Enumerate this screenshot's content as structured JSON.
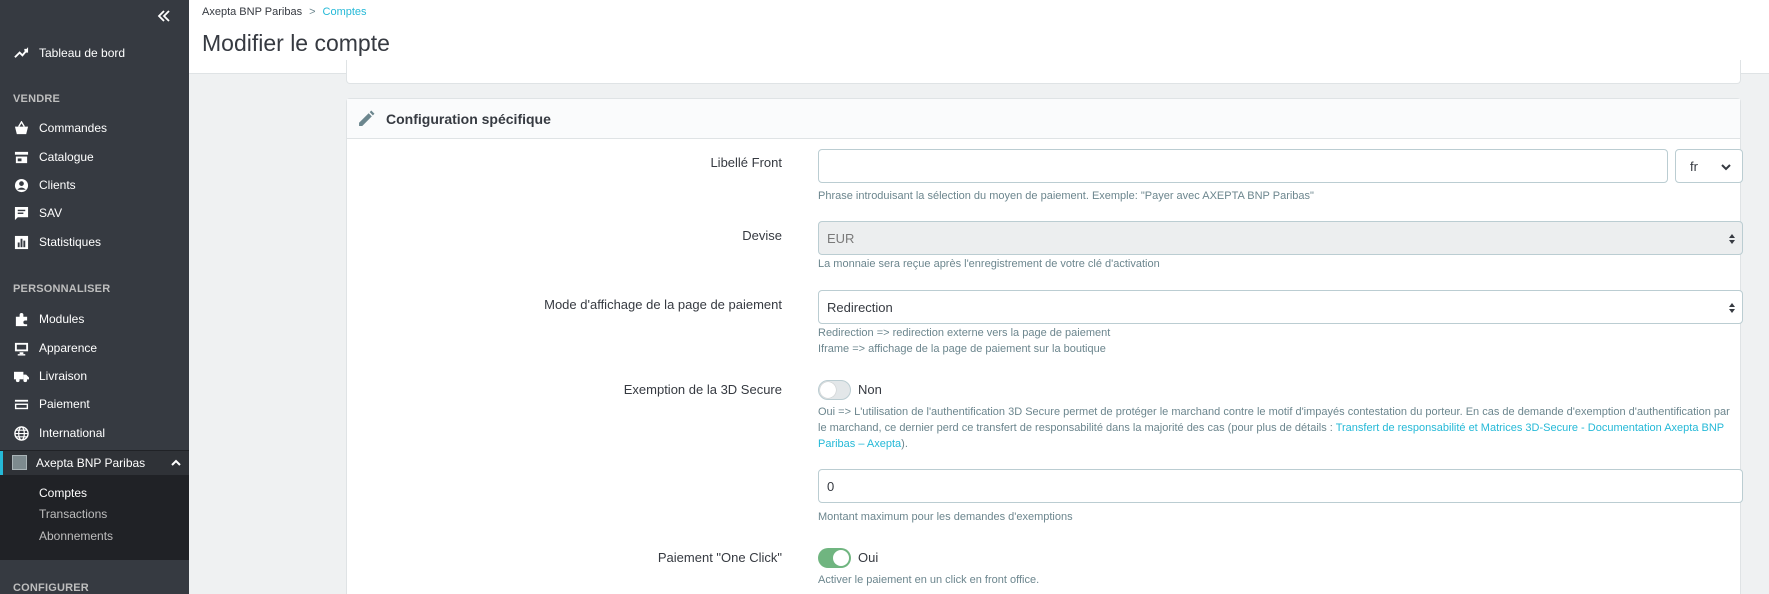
{
  "sidebar": {
    "dashboard": "Tableau de bord",
    "sections": {
      "sell": "VENDRE",
      "customize": "PERSONNALISER",
      "configure": "CONFIGURER"
    },
    "sell_items": [
      {
        "label": "Commandes",
        "icon": "basket-icon"
      },
      {
        "label": "Catalogue",
        "icon": "store-icon"
      },
      {
        "label": "Clients",
        "icon": "user-circle-icon"
      },
      {
        "label": "SAV",
        "icon": "message-icon"
      },
      {
        "label": "Statistiques",
        "icon": "bar-chart-icon"
      }
    ],
    "customize_items": [
      {
        "label": "Modules",
        "icon": "puzzle-icon"
      },
      {
        "label": "Apparence",
        "icon": "monitor-icon"
      },
      {
        "label": "Livraison",
        "icon": "truck-icon"
      },
      {
        "label": "Paiement",
        "icon": "credit-card-icon"
      },
      {
        "label": "International",
        "icon": "globe-icon"
      }
    ],
    "active_module": "Axepta BNP Paribas",
    "sub_items": [
      "Comptes",
      "Transactions",
      "Abonnements"
    ]
  },
  "header": {
    "breadcrumb_parent": "Axepta BNP Paribas",
    "breadcrumb_sep": ">",
    "breadcrumb_current": "Comptes",
    "title": "Modifier le compte"
  },
  "card": {
    "title": "Configuration spécifique",
    "fields": {
      "libelle_front": {
        "label": "Libellé Front",
        "value": "",
        "lang": "fr",
        "help": "Phrase introduisant la sélection du moyen de paiement. Exemple: \"Payer avec AXEPTA BNP Paribas\""
      },
      "devise": {
        "label": "Devise",
        "value": "EUR",
        "help": "La monnaie sera reçue après l'enregistrement de votre clé d'activation"
      },
      "mode_affichage": {
        "label": "Mode d'affichage de la page de paiement",
        "value": "Redirection",
        "help_1": "Redirection => redirection externe vers la page de paiement",
        "help_2": "Iframe => affichage de la page de paiement sur la boutique"
      },
      "exemption_3ds": {
        "label": "Exemption de la 3D Secure",
        "state": "Non",
        "help": "Oui => L'utilisation de l'authentification 3D Secure permet de protéger le marchand contre le motif d'impayés contestation du porteur. En cas de demande d'exemption d'authentification par le marchand, ce dernier perd ce transfert de responsabilité dans la majorité des cas (pour plus de détails : ",
        "help_link": "Transfert de responsabilité et Matrices 3D-Secure - Documentation Axepta BNP Paribas – Axepta",
        "help_end": ").",
        "amount": "0",
        "amount_help": "Montant maximum pour les demandes d'exemptions"
      },
      "one_click": {
        "label": "Paiement \"One Click\"",
        "state": "Oui",
        "help": "Activer le paiement en un click en front office."
      }
    }
  },
  "colors": {
    "accent": "#25b9d7",
    "sidebar": "#363a41",
    "switch_on": "#70b580"
  }
}
